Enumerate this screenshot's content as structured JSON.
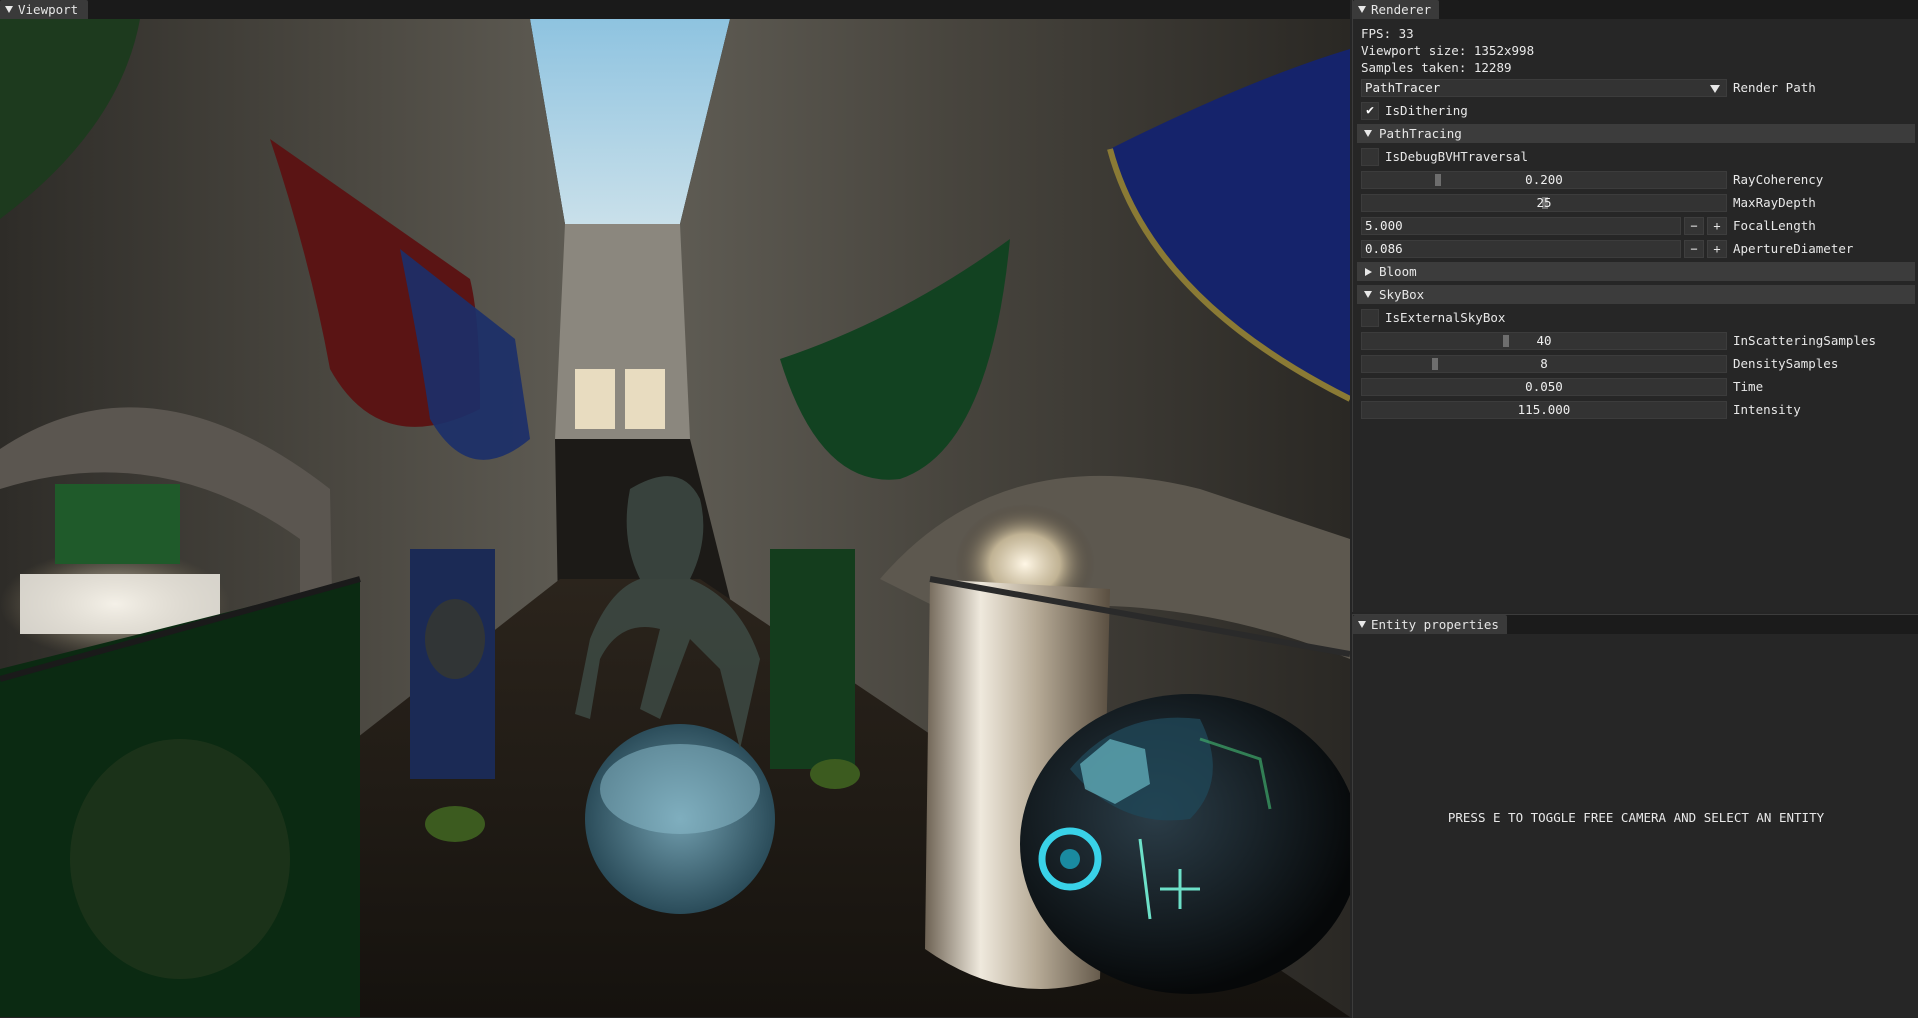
{
  "viewport": {
    "title": "Viewport"
  },
  "renderer": {
    "title": "Renderer",
    "fps": "FPS: 33",
    "viewport_size": "Viewport size: 1352x998",
    "samples_taken": "Samples taken: 12289",
    "render_path": {
      "value": "PathTracer",
      "label": "Render Path"
    },
    "is_dithering": {
      "label": "IsDithering",
      "checked": true
    },
    "path_tracing": {
      "header": "PathTracing",
      "expanded": true,
      "is_debug_bvh": {
        "label": "IsDebugBVHTraversal",
        "checked": false
      },
      "ray_coherency": {
        "value": "0.200",
        "label": "RayCoherency",
        "fraction": 0.2
      },
      "max_ray_depth": {
        "value": "25",
        "label": "MaxRayDepth",
        "fraction": 0.5
      },
      "focal_length": {
        "value": "5.000",
        "label": "FocalLength",
        "minus": "−",
        "plus": "+"
      },
      "aperture_diameter": {
        "value": "0.086",
        "label": "ApertureDiameter",
        "minus": "−",
        "plus": "+"
      }
    },
    "bloom": {
      "header": "Bloom",
      "expanded": false
    },
    "skybox": {
      "header": "SkyBox",
      "expanded": true,
      "is_external": {
        "label": "IsExternalSkyBox",
        "checked": false
      },
      "in_scattering_samples": {
        "value": "40",
        "label": "InScatteringSamples",
        "fraction": 0.39
      },
      "density_samples": {
        "value": "8",
        "label": "DensitySamples",
        "fraction": 0.19
      },
      "time": {
        "value": "0.050",
        "label": "Time"
      },
      "intensity": {
        "value": "115.000",
        "label": "Intensity"
      }
    }
  },
  "entity_properties": {
    "title": "Entity properties",
    "message": "PRESS E TO TOGGLE FREE CAMERA AND SELECT AN ENTITY"
  },
  "colors": {
    "panel_bg": "#262626",
    "header_bg": "#3c3c3c",
    "field_bg": "#333333",
    "text": "#e8e8e8"
  }
}
